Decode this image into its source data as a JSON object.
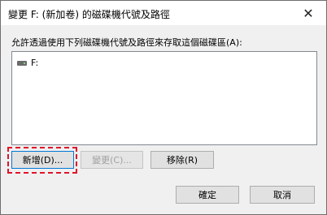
{
  "window": {
    "title": "變更 F: (新加卷) 的磁碟機代號及路徑",
    "close_glyph": "✕"
  },
  "prompt": "允許透過使用下列磁碟機代號及路徑來存取這個磁碟區(A):",
  "list": {
    "items": [
      {
        "label": "F:",
        "icon": "drive-icon"
      }
    ]
  },
  "buttons": {
    "add": "新增(D)...",
    "change": "變更(C)...",
    "remove": "移除(R)",
    "ok": "確定",
    "cancel": "取消"
  },
  "colors": {
    "highlight": "#e0142b",
    "focus": "#0078d7"
  }
}
